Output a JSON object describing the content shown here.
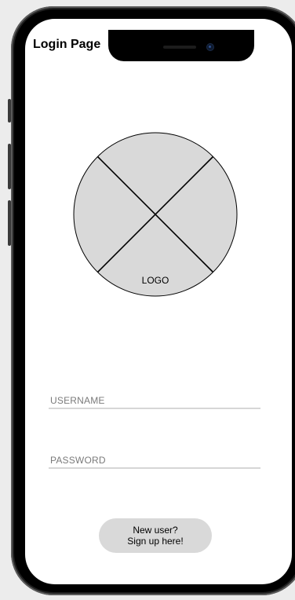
{
  "header": {
    "title": "Login Page"
  },
  "logo": {
    "label": "LOGO",
    "fill_color": "#d9d9d9"
  },
  "form": {
    "username_placeholder": "USERNAME",
    "username_value": "",
    "password_placeholder": "PASSWORD",
    "password_value": ""
  },
  "signup": {
    "line1": "New user?",
    "line2": "Sign up here!"
  },
  "icons": {
    "logo": "placeholder-x-circle-icon",
    "camera": "front-camera-icon"
  }
}
